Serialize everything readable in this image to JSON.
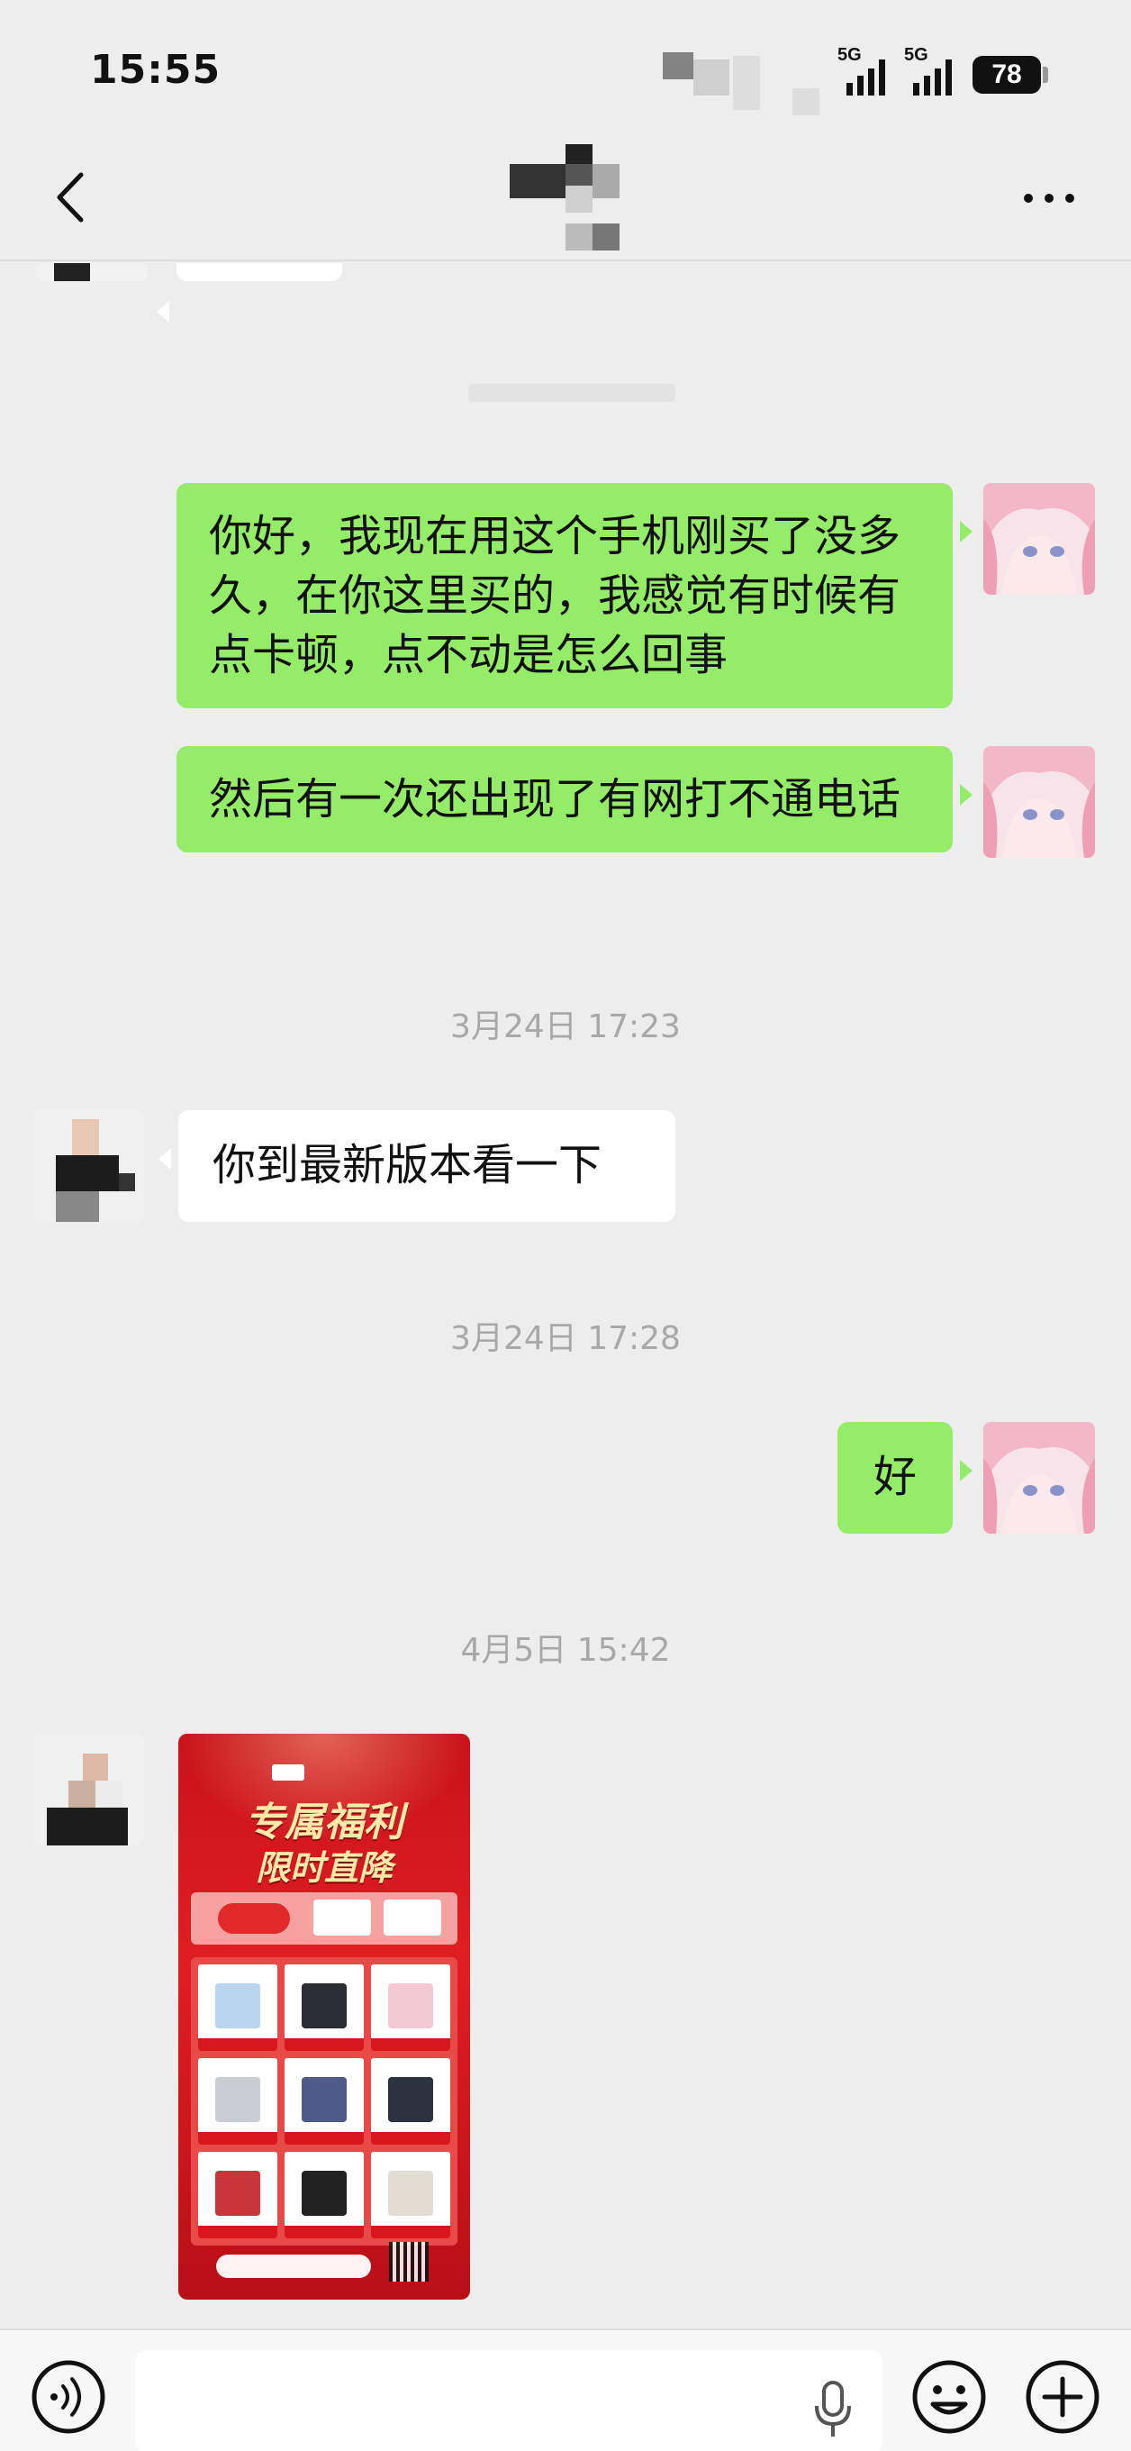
{
  "status_bar": {
    "time": "15:55",
    "network_1": "5G",
    "network_2": "5G",
    "battery": "78"
  },
  "nav": {
    "back_icon": "chevron-left-icon",
    "more_icon": "more-dots-icon"
  },
  "messages": [
    {
      "from": "me",
      "text": "你好，我现在用这个手机刚买了没多久，在你这里买的，我感觉有时候有点卡顿，点不动是怎么回事"
    },
    {
      "from": "me",
      "text": "然后有一次还出现了有网打不通电话"
    },
    {
      "type": "timestamp",
      "text": "3月24日 17:23"
    },
    {
      "from": "other",
      "text": "你到最新版本看一下"
    },
    {
      "type": "timestamp",
      "text": "3月24日 17:28"
    },
    {
      "from": "me",
      "text": "好"
    },
    {
      "type": "timestamp",
      "text": "4月5日 15:42"
    },
    {
      "from": "other",
      "type": "image",
      "title_line1": "专属福利",
      "title_line2": "限时直降"
    }
  ],
  "input_bar": {
    "placeholder": "",
    "voice_icon": "voice-icon",
    "mic_icon": "mic-icon",
    "emoji_icon": "emoji-icon",
    "plus_icon": "plus-icon"
  },
  "colors": {
    "background": "#ededed",
    "my_bubble": "#95ec69",
    "other_bubble": "#ffffff",
    "poster_red": "#d8161d"
  }
}
